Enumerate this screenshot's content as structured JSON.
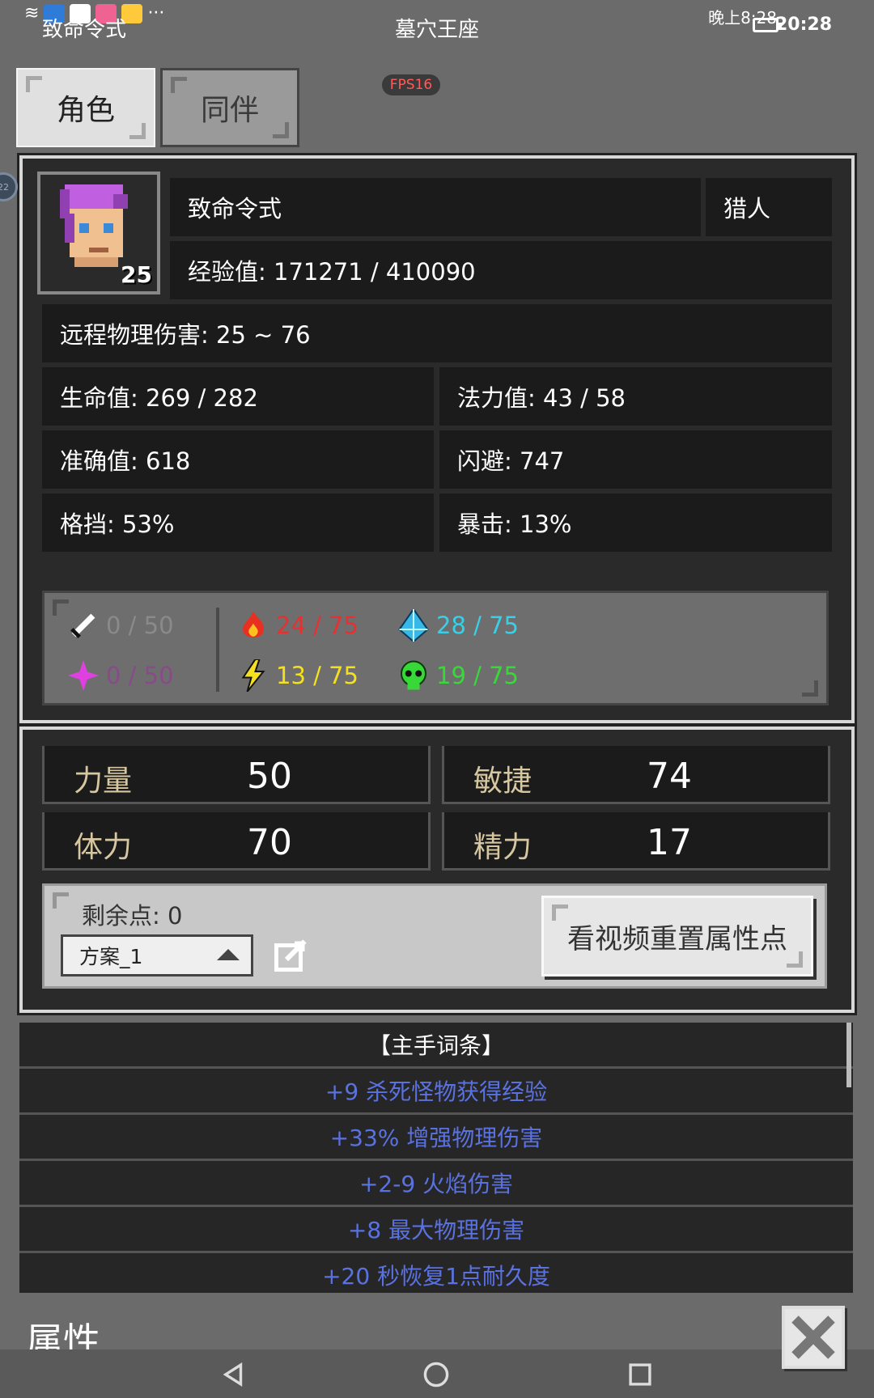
{
  "status_bar": {
    "app_name": "致命令式",
    "title": "墓穴王座",
    "time_label": "晚上8:28",
    "clock": "20:28",
    "overflow": "···"
  },
  "tabs": [
    {
      "label": "角色",
      "active": true
    },
    {
      "label": "同伴",
      "active": false
    }
  ],
  "fps": "FPS16",
  "side_bubble": "22",
  "character": {
    "name": "致命令式",
    "class": "猎人",
    "level": "25",
    "exp": "经验值: 171271 / 410090",
    "damage": "远程物理伤害: 25 ~ 76",
    "hp": "生命值: 269 / 282",
    "mp": "法力值: 43 / 58",
    "accuracy": "准确值: 618",
    "evasion": "闪避: 747",
    "block": "格挡: 53%",
    "crit": "暴击: 13%"
  },
  "resistances": [
    {
      "name": "physical",
      "value": "0 / 50",
      "color": "#8a8a8a",
      "icon": "sword-icon"
    },
    {
      "name": "arcane",
      "value": "0 / 50",
      "color": "#8a4a8a",
      "icon": "magic-star-icon"
    },
    {
      "name": "fire",
      "value": "24 / 75",
      "color": "#e83030",
      "icon": "fire-icon"
    },
    {
      "name": "lightning",
      "value": "13 / 75",
      "color": "#f5e020",
      "icon": "lightning-icon"
    },
    {
      "name": "cold",
      "value": "28 / 75",
      "color": "#38d0e8",
      "icon": "ice-crystal-icon"
    },
    {
      "name": "poison",
      "value": "19 / 75",
      "color": "#38d838",
      "icon": "skull-icon"
    }
  ],
  "attributes": {
    "strength": {
      "label": "力量",
      "value": "50"
    },
    "agility": {
      "label": "敏捷",
      "value": "74"
    },
    "stamina": {
      "label": "体力",
      "value": "70"
    },
    "energy": {
      "label": "精力",
      "value": "17"
    }
  },
  "points": {
    "remaining": "剩余点: 0",
    "plan": "方案_1",
    "reset_button": "看视频重置属性点"
  },
  "affixes": {
    "header": "【主手词条】",
    "items": [
      "+9 杀死怪物获得经验",
      "+33% 增强物理伤害",
      "+2-9 火焰伤害",
      "+8 最大物理伤害",
      "+20 秒恢复1点耐久度"
    ]
  },
  "footer": {
    "title": "属性"
  }
}
